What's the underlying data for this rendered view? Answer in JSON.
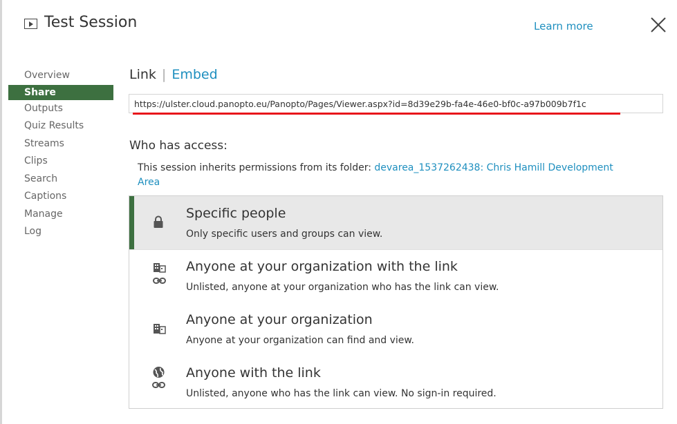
{
  "header": {
    "title": "Test Session",
    "learn_more": "Learn more",
    "icons": {
      "session": "play-box-icon",
      "close": "close-icon"
    }
  },
  "sidebar": {
    "items": [
      {
        "label": "Overview",
        "active": false
      },
      {
        "label": "Share",
        "active": true
      },
      {
        "label": "Outputs",
        "active": false
      },
      {
        "label": "Quiz Results",
        "active": false
      },
      {
        "label": "Streams",
        "active": false
      },
      {
        "label": "Clips",
        "active": false
      },
      {
        "label": "Search",
        "active": false
      },
      {
        "label": "Captions",
        "active": false
      },
      {
        "label": "Manage",
        "active": false
      },
      {
        "label": "Log",
        "active": false
      }
    ]
  },
  "tabs": {
    "link": "Link",
    "embed": "Embed",
    "separator": "|"
  },
  "share_url": "https://ulster.cloud.panopto.eu/Panopto/Pages/Viewer.aspx?id=8d39e29b-fa4e-46e0-bf0c-a97b009b7f1c",
  "access": {
    "heading": "Who has access:",
    "inherits_text": "This session inherits permissions from its folder: ",
    "folder_link": "devarea_1537262438: Chris Hamill Development Area",
    "options": [
      {
        "title": "Specific people",
        "description": "Only specific users and groups can view.",
        "icon": "lock-icon",
        "selected": true
      },
      {
        "title": "Anyone at your organization with the link",
        "description": "Unlisted, anyone at your organization who has the link can view.",
        "icon": "organization-link-icon",
        "selected": false
      },
      {
        "title": "Anyone at your organization",
        "description": "Anyone at your organization can find and view.",
        "icon": "organization-icon",
        "selected": false
      },
      {
        "title": "Anyone with the link",
        "description": "Unlisted, anyone who has the link can view. No sign-in required.",
        "icon": "globe-link-icon",
        "selected": false
      }
    ]
  },
  "colors": {
    "accent_green": "#3d7040",
    "link_blue": "#1e8fbf",
    "highlight_red": "#e8141b"
  }
}
